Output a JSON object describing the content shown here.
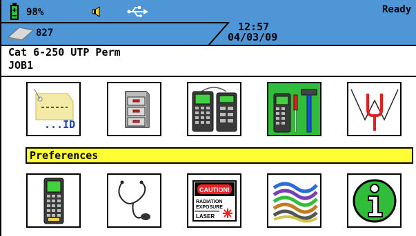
{
  "status": {
    "battery_percent": "98%",
    "memory_count": "827",
    "time": "12:57",
    "date": "04/03/09",
    "state": "Ready",
    "battery_icon": "battery-icon",
    "speaker_icon": "speaker-icon",
    "usb_icon": "usb-icon",
    "memory_icon": "memory-card-icon"
  },
  "info": {
    "cable_type": "Cat 6-250 UTP Perm",
    "job_name": "JOB1"
  },
  "selected_label": "Preferences",
  "colors": {
    "statusbar": "#4f96d6",
    "selected_bg": "#2fbd3a",
    "label_bar": "#ffff33"
  },
  "icons_row1": [
    {
      "name": "id-tag-icon",
      "label": "...ID"
    },
    {
      "name": "file-cabinet-icon"
    },
    {
      "name": "dual-tester-icon"
    },
    {
      "name": "tools-icon"
    },
    {
      "name": "tuning-fork-icon"
    }
  ],
  "icons_row2": [
    {
      "name": "tester-icon"
    },
    {
      "name": "stethoscope-icon"
    },
    {
      "name": "laser-caution-icon",
      "caution": "CAUTION!",
      "radiation": "RADIATION",
      "exposure": "EXPOSURE",
      "laser": "LASER"
    },
    {
      "name": "fiber-cables-icon"
    },
    {
      "name": "info-icon"
    }
  ]
}
